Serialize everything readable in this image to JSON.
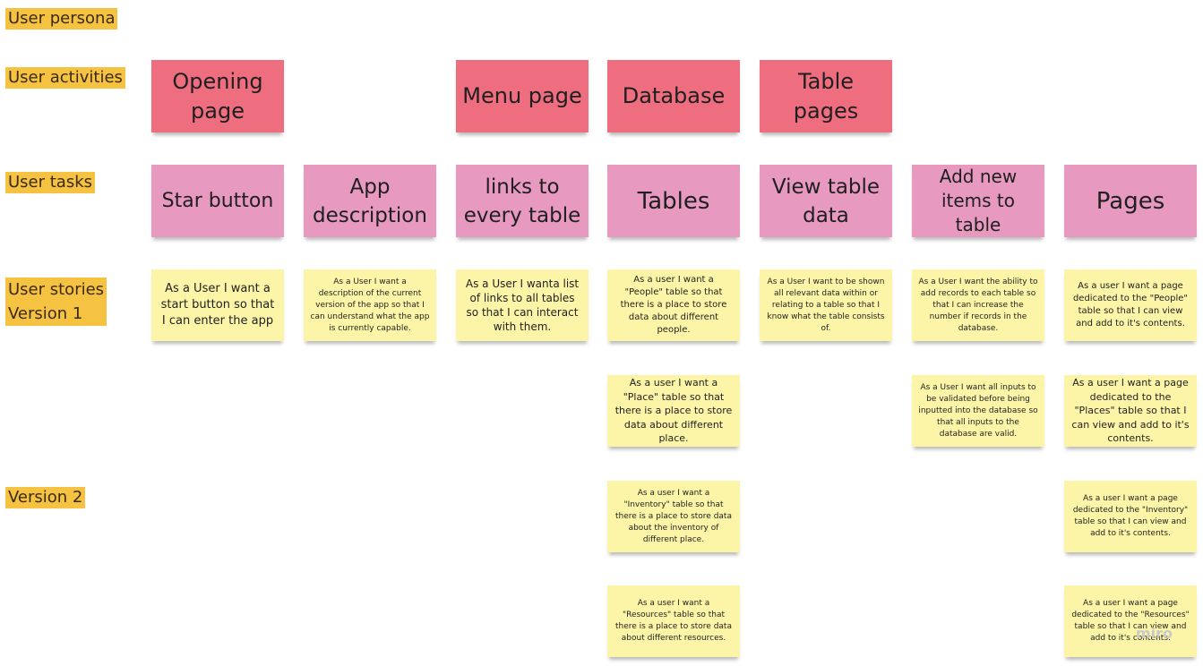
{
  "row_labels": {
    "persona": "User persona",
    "activities": "User activities",
    "tasks": "User tasks",
    "stories_v1": "User stories\nVersion 1",
    "version2": "Version 2"
  },
  "activities": {
    "opening_page": "Opening page",
    "menu_page": "Menu page",
    "database": "Database",
    "table_pages": "Table pages"
  },
  "tasks": {
    "star_button": "Star button",
    "app_description": "App description",
    "links_to_tables": "links to every table",
    "tables": "Tables",
    "view_table_data": "View table data",
    "add_new_items": "Add new items to table",
    "pages": "Pages"
  },
  "stories": {
    "start_button": "As a User I want a start button so that I can enter the app",
    "description": "As a User I want a description of the current version of the app so that I can understand what the app is currently capable.",
    "links": "As a User I wanta list of links to all tables so that I can interact with them.",
    "people_table": "As a user I want a \"People\" table so that there is a place to store data about different people.",
    "view_data": "As a User I want to be shown all relevant data within or relating to a table so that I know what the table consists of.",
    "add_records": "As a User I want the ability to add records  to each table so that I can increase the number if records in the database.",
    "people_page": "As a user I want a page dedicated to the \"People\" table so that I can view and add to it's contents.",
    "place_table": "As a user I want a \"Place\" table so that there is a place to store data about different place.",
    "validate_inputs": "As a User I want all inputs to be validated before being inputted into the database so that all inputs to the database are valid.",
    "places_page": "As a user I want a page dedicated to the \"Places\" table so that I can view and add to it's contents.",
    "inventory_table": "As a user I want a \"Inventory\" table so that there is a place to store data about the inventory of different place.",
    "inventory_page": "As a user I want a page dedicated to the \"Inventory\" table so that I can view and add to it's contents.",
    "resources_table": "As a user I want a \"Resources\" table so that there is a place to store data about different resources.",
    "resources_page": "As a user I want a page dedicated to the \"Resources\" table so that I can view and add to it's contents."
  },
  "watermark": "miro",
  "colors": {
    "activity": "#ee6e80",
    "task": "#e899c0",
    "story": "#fcf5a7",
    "label": "#f5c242"
  }
}
